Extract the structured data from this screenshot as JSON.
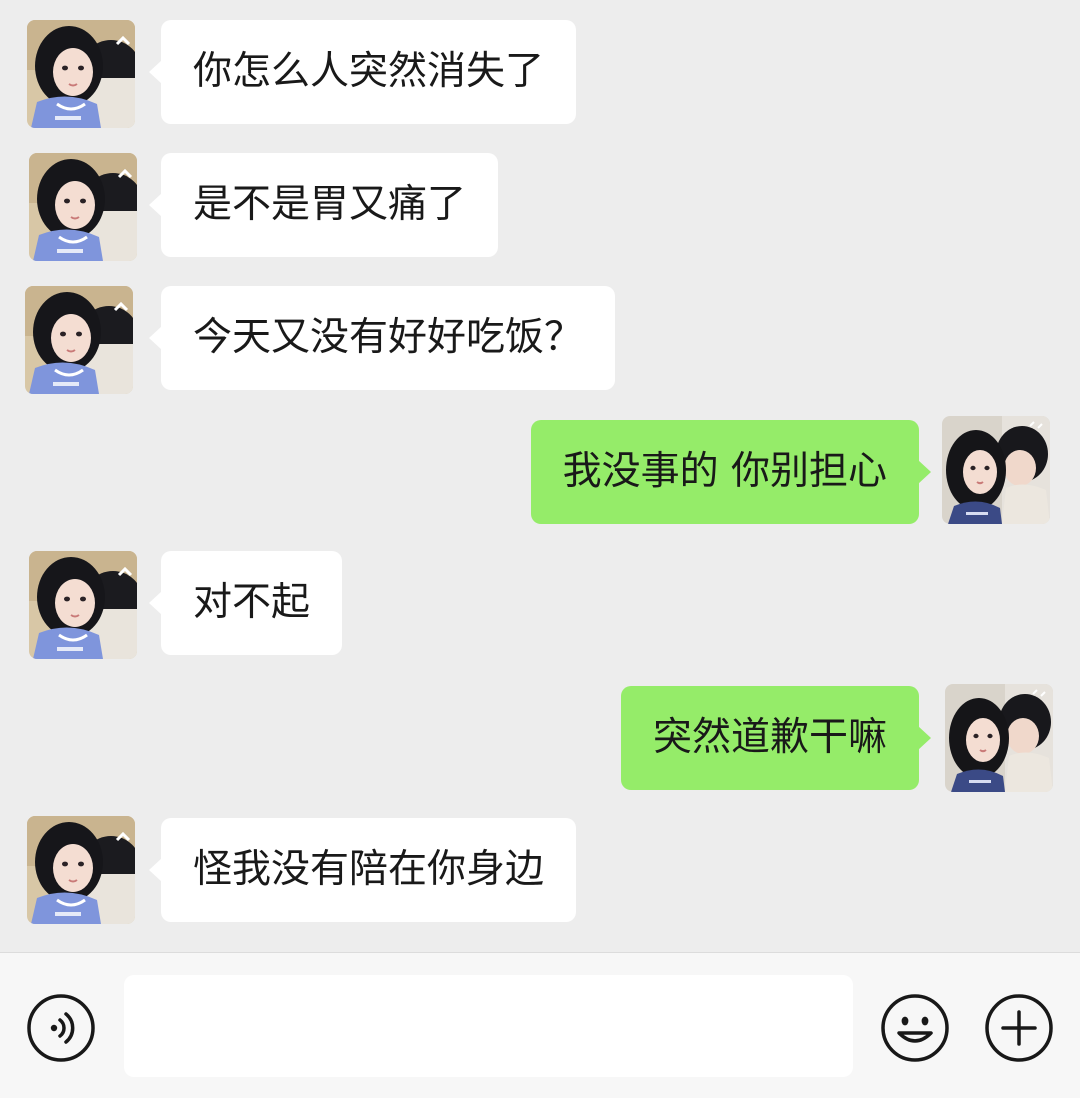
{
  "messages": [
    {
      "side": "in",
      "text": "你怎么人突然消失了"
    },
    {
      "side": "in",
      "text": "是不是胃又痛了"
    },
    {
      "side": "in",
      "text": "今天又没有好好吃饭？"
    },
    {
      "side": "out",
      "text": "我没事的 你别担心"
    },
    {
      "side": "in",
      "text": "对不起"
    },
    {
      "side": "out",
      "text": "突然道歉干嘛"
    },
    {
      "side": "in",
      "text": "怪我没有陪在你身边"
    }
  ],
  "composer": {
    "input_value": "",
    "voice_icon": "voice-icon",
    "emoji_icon": "emoji-icon",
    "plus_icon": "plus-icon"
  },
  "colors": {
    "background": "#ededed",
    "incoming_bubble": "#ffffff",
    "outgoing_bubble": "#95ec69",
    "composer_bar": "#f7f7f7"
  }
}
